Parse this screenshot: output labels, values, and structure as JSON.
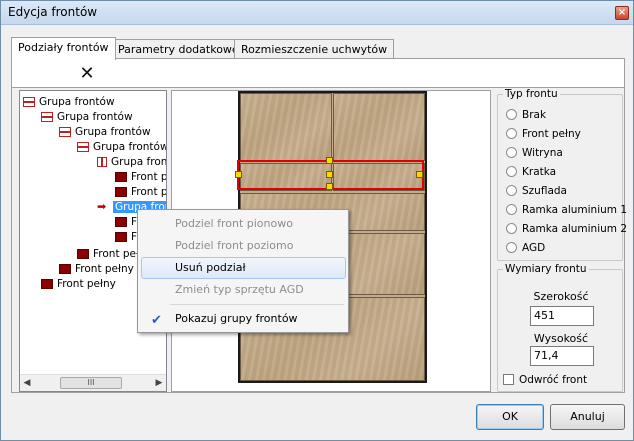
{
  "window": {
    "title": "Edycja frontów"
  },
  "tabs": [
    {
      "label": "Podziały frontów",
      "active": true
    },
    {
      "label": "Parametry dodatkowe",
      "active": false
    },
    {
      "label": "Rozmieszczenie uchwytów",
      "active": false
    }
  ],
  "toolbar": {
    "delete_icon": "close-x-icon"
  },
  "tree": {
    "items": [
      {
        "label": "Grupa frontów",
        "icon": "group-horizontal-icon"
      },
      {
        "label": "Grupa frontów",
        "icon": "group-horizontal-icon"
      },
      {
        "label": "Grupa frontów",
        "icon": "group-horizontal-icon"
      },
      {
        "label": "Grupa frontów",
        "icon": "group-horizontal-icon"
      },
      {
        "label": "Grupa front",
        "icon": "group-vertical-icon"
      },
      {
        "label": "Front p",
        "icon": "front-icon"
      },
      {
        "label": "Front p",
        "icon": "front-icon"
      },
      {
        "label": "Grupa front",
        "icon": "arrow-icon",
        "selected": true
      },
      {
        "label": "F",
        "icon": "front-icon"
      },
      {
        "label": "F",
        "icon": "front-icon"
      },
      {
        "label": "Front peł",
        "icon": "front-icon"
      },
      {
        "label": "Front pełny",
        "icon": "front-icon"
      },
      {
        "label": "Front pełny",
        "icon": "front-icon"
      }
    ],
    "scroll_thumb_label": "III"
  },
  "context_menu": {
    "items": [
      {
        "label": "Podziel front pionowo",
        "disabled": true
      },
      {
        "label": "Podziel front poziomo",
        "disabled": true
      },
      {
        "label": "Usuń podział",
        "disabled": false,
        "hover": true
      },
      {
        "label": "Zmień typ sprzętu AGD",
        "disabled": true
      },
      {
        "label": "Pokazuj grupy frontów",
        "disabled": false,
        "checked": true
      }
    ]
  },
  "typ_frontu": {
    "legend": "Typ frontu",
    "options": [
      "Brak",
      "Front pełny",
      "Witryna",
      "Kratka",
      "Szuflada",
      "Ramka aluminium 1",
      "Ramka aluminium 2",
      "AGD"
    ]
  },
  "wymiary_frontu": {
    "legend": "Wymiary frontu",
    "width_label": "Szerokość",
    "width_value": "451",
    "height_label": "Wysokość",
    "height_value": "71,4",
    "flip_label": "Odwróć front"
  },
  "buttons": {
    "ok": "OK",
    "cancel": "Anuluj"
  },
  "colors": {
    "selection": "#3399ff",
    "front_icon": "#8b0000",
    "selection_outline": "#e00000",
    "handle": "#ffd800"
  }
}
